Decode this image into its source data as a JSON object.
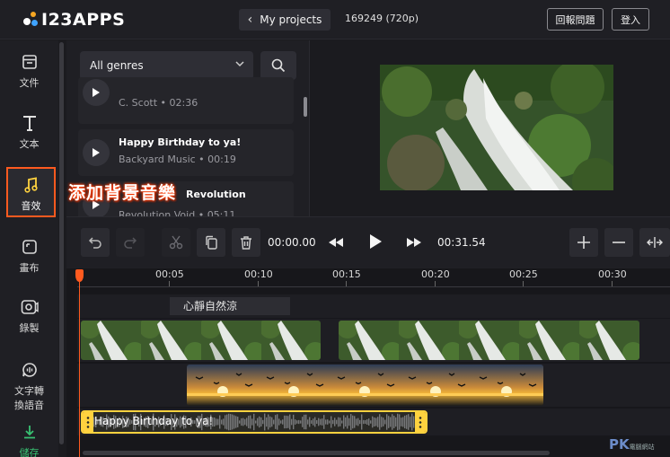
{
  "app": {
    "logo_text": "I23APPS",
    "brand_colors": {
      "orange": "#f5a623",
      "blue": "#3fa3ff",
      "accent": "#ff5a1f",
      "audio": "#ffd23f",
      "save": "#38c172"
    }
  },
  "header": {
    "back_label": "My projects",
    "project_info": "169249 (720p)",
    "report_label": "回報問題",
    "login_label": "登入"
  },
  "sidebar": {
    "items": [
      {
        "label": "文件",
        "icon": "file-icon"
      },
      {
        "label": "文本",
        "icon": "text-icon"
      },
      {
        "label": "音效",
        "icon": "music-note-icon",
        "active": true
      },
      {
        "label": "畫布",
        "icon": "canvas-icon"
      },
      {
        "label": "錄製",
        "icon": "record-icon"
      },
      {
        "label": "文字轉",
        "label2": "換語音",
        "icon": "speech-icon"
      },
      {
        "label": "儲存",
        "icon": "download-icon"
      }
    ]
  },
  "music": {
    "genre_selected": "All genres",
    "overlay_label": "添加背景音樂",
    "tracks": [
      {
        "title": "",
        "artist": "C. Scott",
        "duration": "02:36"
      },
      {
        "title": "Happy Birthday to ya!",
        "artist": "Backyard Music",
        "duration": "00:19"
      },
      {
        "title": "Revolution",
        "artist": "Revolution Void",
        "duration": "05:11"
      }
    ]
  },
  "toolbar": {
    "current_time": "00:00.00",
    "total_time": "00:31.54"
  },
  "timeline": {
    "ruler": [
      "00:05",
      "00:10",
      "00:15",
      "00:20",
      "00:25",
      "00:30"
    ],
    "text_clip": "心靜自然涼",
    "audio_clip": "Happy Birthday to ya!"
  },
  "watermark": {
    "text": "PK",
    "sub": "電腦網站"
  }
}
